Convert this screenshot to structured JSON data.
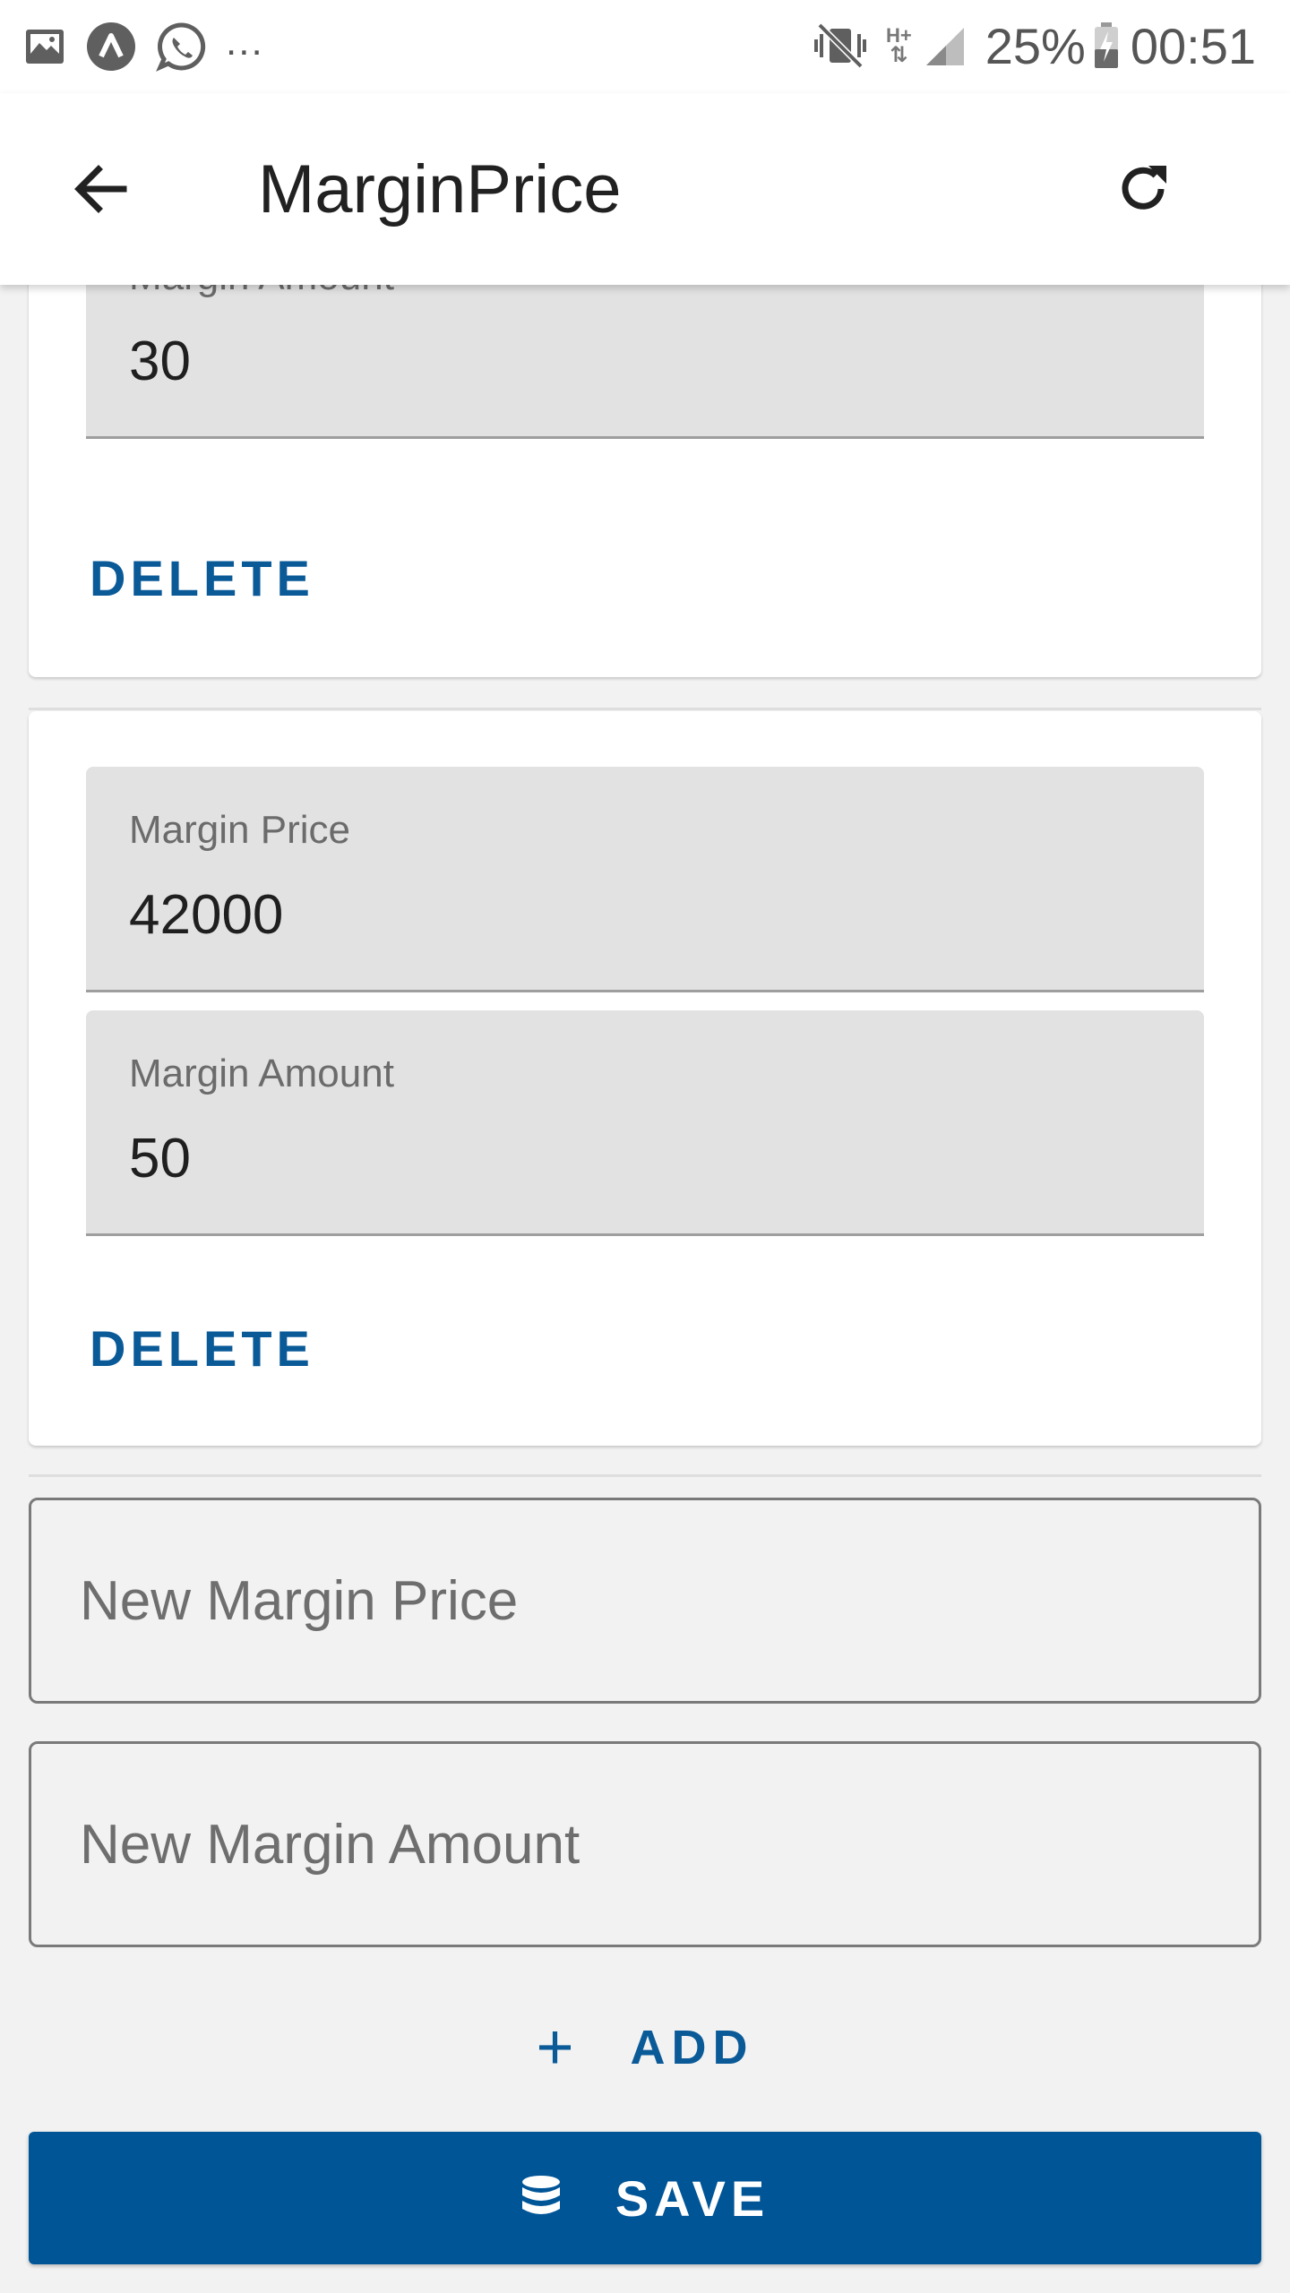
{
  "status_bar": {
    "overflow_dots": "...",
    "network_label": "H+",
    "battery_percent": "25%",
    "time": "00:51"
  },
  "app_bar": {
    "title": "MarginPrice"
  },
  "cards": [
    {
      "margin_amount_label": "Margin Amount",
      "margin_amount_value": "30",
      "delete_label": "DELETE"
    },
    {
      "margin_price_label": "Margin Price",
      "margin_price_value": "42000",
      "margin_amount_label": "Margin Amount",
      "margin_amount_value": "50",
      "delete_label": "DELETE"
    }
  ],
  "new_entry": {
    "price_placeholder": "New Margin Price",
    "amount_placeholder": "New Margin Amount",
    "price_value": "",
    "amount_value": ""
  },
  "add_button": {
    "icon": "plus-icon",
    "label": "ADD"
  },
  "save_button": {
    "icon": "database-icon",
    "label": "SAVE"
  },
  "colors": {
    "accent": "#0a5a98",
    "save_bg": "#005597",
    "field_bg": "#e2e2e2",
    "page_bg": "#f2f2f2"
  }
}
